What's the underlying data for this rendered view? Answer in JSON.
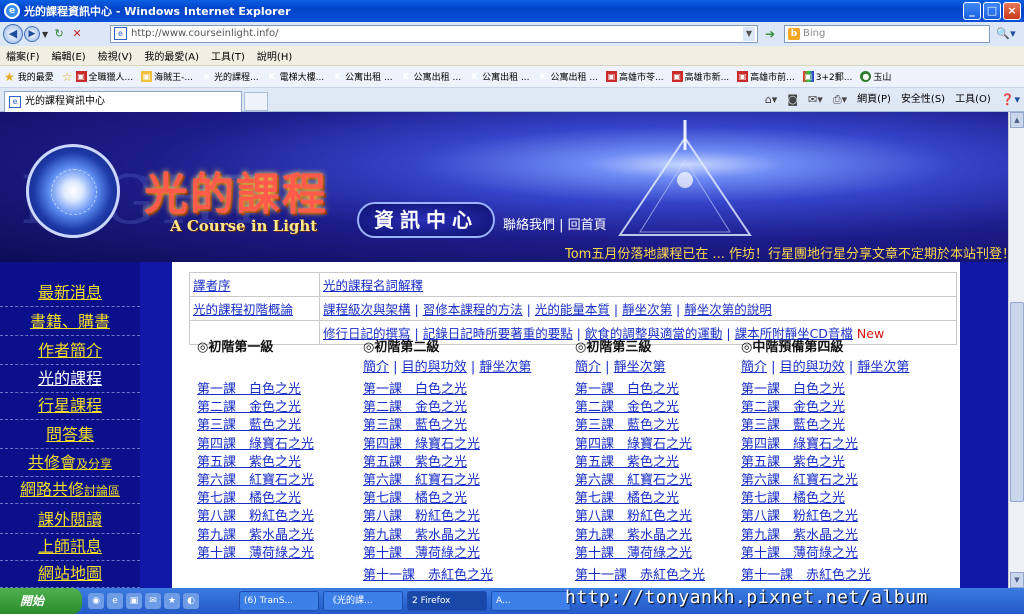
{
  "window": {
    "title": "光的課程資訊中心 - Windows Internet Explorer"
  },
  "address": {
    "url": "http://www.courseinlight.info/",
    "search_placeholder": "Bing"
  },
  "menu": [
    "檔案(F)",
    "編輯(E)",
    "檢視(V)",
    "我的最愛(A)",
    "工具(T)",
    "說明(H)"
  ],
  "favorites": {
    "label": "我的最愛",
    "items": [
      "全職獵人...",
      "海賊王-...",
      "光的課程...",
      "電梯大樓...",
      "公寓出租 ...",
      "公寓出租 ...",
      "公寓出租 ...",
      "公寓出租 ...",
      "高雄市苓...",
      "高雄市新...",
      "高雄市前...",
      "3+2郵...",
      "玉山"
    ]
  },
  "tab": {
    "title": "光的課程資訊中心"
  },
  "commands": [
    "網頁(P)",
    "安全性(S)",
    "工具(O)"
  ],
  "banner": {
    "title": "光的課程",
    "subtitle": "A Course in Light",
    "info_center": "資訊中心",
    "contact": "聯絡我們",
    "home": "回首頁",
    "marquee": "Tom五月份落地課程已在 ... 作坊！行星團地行星分享文章不定期於本站刊登！"
  },
  "sidebar": {
    "items": [
      {
        "label": "最新消息"
      },
      {
        "label": "書籍、購書"
      },
      {
        "label": "作者簡介"
      },
      {
        "label": "光的課程"
      },
      {
        "label": "行星課程"
      },
      {
        "label": "問答集"
      },
      {
        "label": "共修會",
        "small": "及分享"
      },
      {
        "label": "網路共修",
        "small": "討論區"
      },
      {
        "label": "課外閱讀"
      },
      {
        "label": "上師訊息"
      },
      {
        "label": "網站地圖"
      }
    ]
  },
  "toplinks": {
    "r1a": "譯者序",
    "r1b": "光的課程名詞解釋",
    "r2a": "光的課程初階概論",
    "r2": [
      "課程級次與架構",
      "習修本課程的方法",
      "光的能量本質",
      "靜坐次第",
      "靜坐次第的說明"
    ],
    "r3": [
      "修行日記的撰寫",
      "記錄日記時所要著重的要點",
      "飲食的調整與適當的運動",
      "課本所附靜坐CD音檔"
    ],
    "new_label": "New"
  },
  "columns": [
    {
      "heading": "◎初階第一級",
      "sub": [],
      "lessons": [
        "第一課　白色之光",
        "第二課　金色之光",
        "第三課　藍色之光",
        "第四課　綠寶石之光",
        "第五課　紫色之光",
        "第六課　紅寶石之光",
        "第七課　橘色之光",
        "第八課　粉紅色之光",
        "第九課　紫水晶之光",
        "第十課　薄荷綠之光"
      ]
    },
    {
      "heading": "◎初階第二級",
      "sub": [
        "簡介",
        "目的與功效",
        "靜坐次第"
      ],
      "lessons": [
        "第一課　白色之光",
        "第二課　金色之光",
        "第三課　藍色之光",
        "第四課　綠寶石之光",
        "第五課　紫色之光",
        "第六課　紅寶石之光",
        "第七課　橘色之光",
        "第八課　粉紅色之光",
        "第九課　紫水晶之光",
        "第十課　薄荷綠之光",
        "第十一課　赤紅色之光"
      ]
    },
    {
      "heading": "◎初階第三級",
      "sub": [
        "簡介",
        "靜坐次第"
      ],
      "lessons": [
        "第一課　白色之光",
        "第二課　金色之光",
        "第三課　藍色之光",
        "第四課　綠寶石之光",
        "第五課　紫色之光",
        "第六課　紅寶石之光",
        "第七課　橘色之光",
        "第八課　粉紅色之光",
        "第九課　紫水晶之光",
        "第十課　薄荷綠之光",
        "第十一課　赤紅色之光"
      ]
    },
    {
      "heading": "◎中階預備第四級",
      "sub": [
        "簡介",
        "目的與功效",
        "靜坐次第"
      ],
      "lessons": [
        "第一課　白色之光",
        "第二課　金色之光",
        "第三課　藍色之光",
        "第四課　綠寶石之光",
        "第五課　紫色之光",
        "第六課　紅寶石之光",
        "第七課　橘色之光",
        "第八課　粉紅色之光",
        "第九課　紫水晶之光",
        "第十課　薄荷綠之光",
        "第十一課　赤紅色之光"
      ]
    }
  ],
  "taskbar": {
    "start": "開始",
    "tasks": [
      "(6) TranS...",
      "《光的課...",
      "2 Firefox",
      "A..."
    ]
  },
  "watermark": "http://tonyankh.pixnet.net/album",
  "colors": {
    "link": "#1a2fc8",
    "nav_text": "#f3dd2a",
    "page_bg": "#1118a8",
    "new_tag": "#e01010"
  }
}
